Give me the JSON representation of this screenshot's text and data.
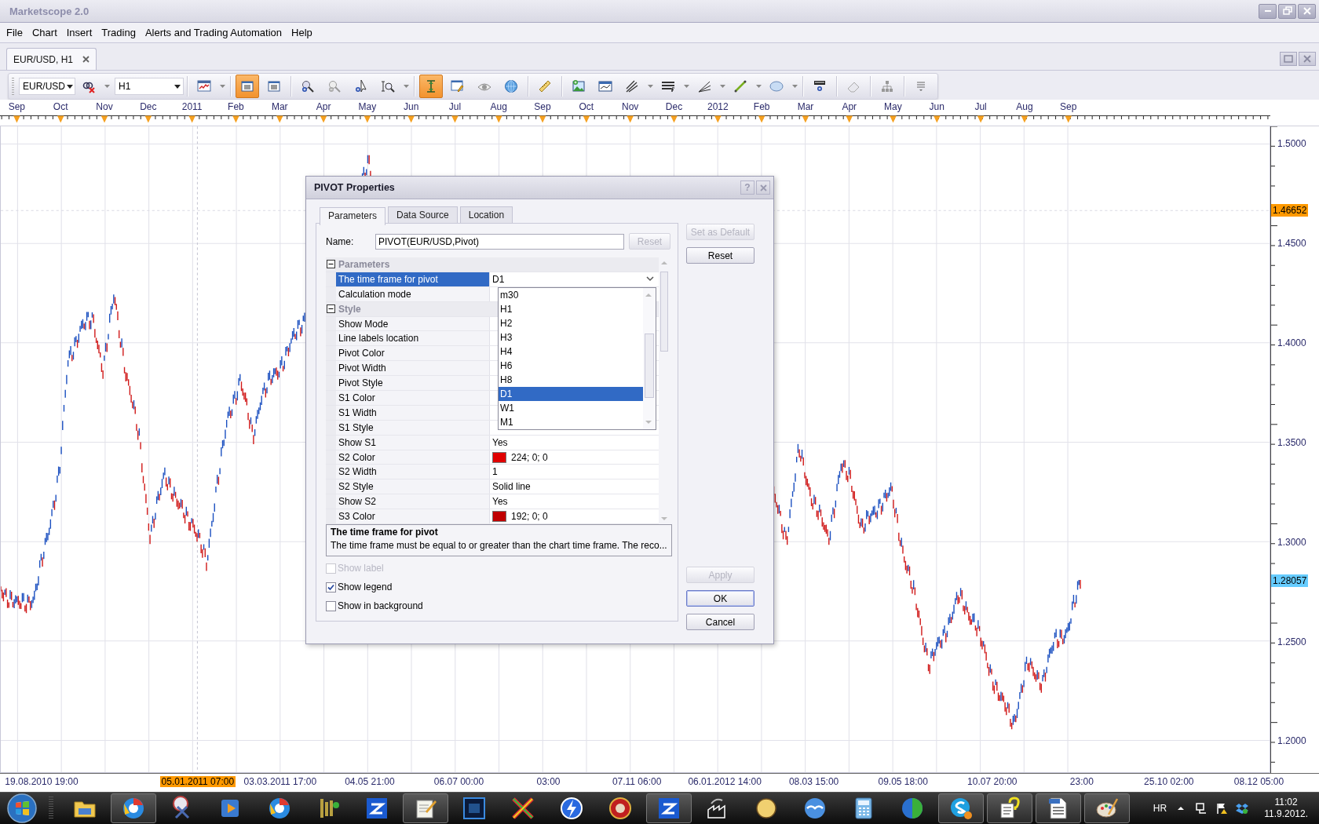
{
  "window": {
    "title": "Marketscope 2.0"
  },
  "menu": [
    "File",
    "Chart",
    "Insert",
    "Trading",
    "Alerts and Trading Automation",
    "Help"
  ],
  "document_tabs": [
    {
      "label": "EUR/USD, H1",
      "selected": true
    }
  ],
  "toolbar": {
    "symbol": "EUR/USD",
    "timeframe": "H1",
    "tools": [
      {
        "on": false
      },
      {
        "on": true
      },
      {
        "on": false
      },
      {
        "on": false
      },
      {
        "on": false
      },
      {
        "on": false
      },
      {
        "on": false
      },
      {
        "on": true
      },
      {
        "on": false
      },
      {
        "on": false
      },
      {
        "on": false
      },
      {
        "on": false
      },
      {
        "on": false
      },
      {
        "on": false
      },
      {
        "on": false
      },
      {
        "on": false
      },
      {
        "on": false
      },
      {
        "on": false
      },
      {
        "on": false
      },
      {
        "on": false
      },
      {
        "on": false
      },
      {
        "on": false
      },
      {
        "on": false
      }
    ]
  },
  "chart": {
    "months": [
      "Sep",
      "Oct",
      "Nov",
      "Dec",
      "2011",
      "Feb",
      "Mar",
      "Apr",
      "May",
      "Jun",
      "Jul",
      "Aug",
      "Sep",
      "Oct",
      "Nov",
      "Dec",
      "2012",
      "Feb",
      "Mar",
      "Apr",
      "May",
      "Jun",
      "Jul",
      "Aug",
      "Sep"
    ],
    "price_labels": [
      "1.5000",
      "1.4500",
      "1.4000",
      "1.3500",
      "1.3000",
      "1.2500",
      "1.2000"
    ],
    "markers": [
      {
        "label": "1.46652",
        "color": "#ff9900"
      },
      {
        "label": "1.28057",
        "color": "#66ccff"
      }
    ],
    "time_labels": [
      {
        "label": "19.08.2010 19:00",
        "highlighted": false
      },
      {
        "label": "05.01.2011 07:00",
        "highlighted": true
      },
      {
        "label": "03.03.2011 17:00",
        "highlighted": false
      },
      {
        "label": "04.05 21:00",
        "highlighted": false
      },
      {
        "label": "06.07 00:00",
        "highlighted": false
      },
      {
        "label": "03:00",
        "highlighted": false
      },
      {
        "label": "07.11 06:00",
        "highlighted": false
      },
      {
        "label": "06.01.2012 14:00",
        "highlighted": false
      },
      {
        "label": "08.03 15:00",
        "highlighted": false
      },
      {
        "label": "09.05 18:00",
        "highlighted": false
      },
      {
        "label": "10.07 20:00",
        "highlighted": false
      },
      {
        "label": "23:00",
        "highlighted": false
      },
      {
        "label": "25.10 02:00",
        "highlighted": false
      },
      {
        "label": "08.12 05:00",
        "highlighted": false
      }
    ]
  },
  "dialog": {
    "title": "PIVOT Properties",
    "help_button": "?",
    "tabs": [
      {
        "label": "Parameters",
        "selected": true
      },
      {
        "label": "Data Source",
        "selected": false
      },
      {
        "label": "Location",
        "selected": false
      }
    ],
    "name_label": "Name:",
    "name_value": "PIVOT(EUR/USD,Pivot)",
    "name_reset": {
      "label": "Reset",
      "disabled": true
    },
    "properties": [
      {
        "name": "Parameters",
        "expanded": true,
        "children": [
          {
            "label": "The time frame for pivot",
            "value": "D1",
            "selected": true
          },
          {
            "label": "Calculation mode",
            "selected": false
          }
        ]
      },
      {
        "name": "Style",
        "expanded": true,
        "children": [
          {
            "label": "Show Mode",
            "selected": false
          },
          {
            "label": "Line labels location",
            "selected": false
          },
          {
            "label": "Pivot Color",
            "selected": false
          },
          {
            "label": "Pivot Width",
            "selected": false
          },
          {
            "label": "Pivot Style",
            "selected": false
          },
          {
            "label": "S1 Color",
            "selected": false
          },
          {
            "label": "S1 Width",
            "selected": false
          },
          {
            "label": "S1 Style",
            "selected": false
          },
          {
            "label": "Show S1",
            "value": "Yes",
            "selected": false
          },
          {
            "label": "S2 Color",
            "value": "224; 0; 0",
            "color": "#e00000",
            "selected": false
          },
          {
            "label": "S2 Width",
            "value": "1",
            "selected": false
          },
          {
            "label": "S2 Style",
            "value": "Solid line",
            "selected": false
          },
          {
            "label": "Show S2",
            "value": "Yes",
            "selected": false
          },
          {
            "label": "S3 Color",
            "value": "192; 0; 0",
            "color": "#c00000",
            "selected": false
          }
        ]
      }
    ],
    "dropdown_options": [
      {
        "label": "m30",
        "selected": false
      },
      {
        "label": "H1",
        "selected": false
      },
      {
        "label": "H2",
        "selected": false
      },
      {
        "label": "H3",
        "selected": false
      },
      {
        "label": "H4",
        "selected": false
      },
      {
        "label": "H6",
        "selected": false
      },
      {
        "label": "H8",
        "selected": false
      },
      {
        "label": "D1",
        "selected": true
      },
      {
        "label": "W1",
        "selected": false
      },
      {
        "label": "M1",
        "selected": false
      }
    ],
    "description": {
      "title": "The time frame for pivot",
      "text": "The time frame must be equal to or greater than the chart time frame. The reco..."
    },
    "checkboxes": [
      {
        "label": "Show label",
        "checked": false,
        "disabled": true
      },
      {
        "label": "Show legend",
        "checked": true,
        "disabled": false
      },
      {
        "label": "Show in background",
        "checked": false,
        "disabled": false
      }
    ],
    "top_buttons": [
      {
        "label": "Set as Default",
        "disabled": true,
        "focused": false
      },
      {
        "label": "Reset",
        "disabled": false,
        "focused": false
      }
    ],
    "bottom_buttons": [
      {
        "label": "Apply",
        "disabled": true,
        "focused": false
      },
      {
        "label": "OK",
        "disabled": false,
        "focused": true
      },
      {
        "label": "Cancel",
        "disabled": false,
        "focused": false
      }
    ]
  },
  "taskbar": {
    "apps": [
      {
        "active": false
      },
      {
        "active": true
      },
      {
        "active": false
      },
      {
        "active": false
      },
      {
        "active": false
      },
      {
        "active": false
      },
      {
        "active": false
      },
      {
        "active": true
      },
      {
        "active": false
      },
      {
        "active": false
      },
      {
        "active": false
      },
      {
        "active": false
      },
      {
        "active": true
      },
      {
        "active": false
      },
      {
        "active": false
      },
      {
        "active": false
      },
      {
        "active": false
      },
      {
        "active": false
      },
      {
        "active": true
      },
      {
        "active": true
      },
      {
        "active": true
      },
      {
        "active": true
      }
    ],
    "language": "HR",
    "time": "11:02",
    "date": "11.9.2012."
  }
}
